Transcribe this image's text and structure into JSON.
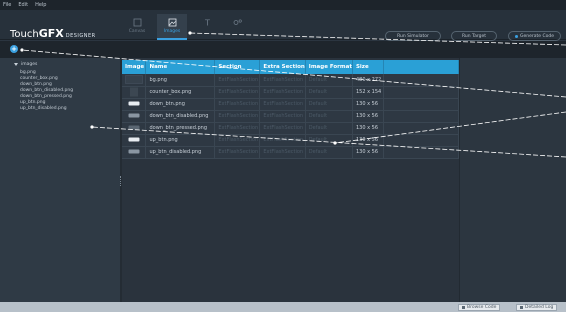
{
  "menu": {
    "file": "File",
    "edit": "Edit",
    "help": "Help"
  },
  "logo": {
    "touch": "Touch",
    "gfx": "GFX",
    "designer": "DESIGNER"
  },
  "tabs": [
    {
      "label": "Canvas",
      "icon": "canvas-icon"
    },
    {
      "label": "Images",
      "icon": "image-icon"
    },
    {
      "label": "",
      "icon": "text-icon"
    },
    {
      "label": "",
      "icon": "config-icon"
    }
  ],
  "actions": {
    "run_simulator": "Run Simulator",
    "run_target": "Run Target",
    "generate_code": "Generate Code"
  },
  "tree": {
    "root": "images",
    "items": [
      "bg.png",
      "counter_box.png",
      "down_btn.png",
      "down_btn_disabled.png",
      "down_btn_pressed.png",
      "up_btn.png",
      "up_btn_disabled.png"
    ]
  },
  "table": {
    "headers": [
      "Image",
      "Name",
      "Section",
      "Extra Section",
      "Image Format",
      "Size"
    ],
    "rows": [
      {
        "name": "bg.png",
        "section": "ExtFlashSection",
        "extra": "ExtFlashSection",
        "format": "Default",
        "size": "480 x 272",
        "thumb": "dark"
      },
      {
        "name": "counter_box.png",
        "section": "ExtFlashSection",
        "extra": "ExtFlashSection",
        "format": "Default",
        "size": "152 x 154",
        "thumb": "box"
      },
      {
        "name": "down_btn.png",
        "section": "ExtFlashSection",
        "extra": "ExtFlashSection",
        "format": "Default",
        "size": "130 x 56",
        "thumb": "btn"
      },
      {
        "name": "down_btn_disabled.png",
        "section": "ExtFlashSection",
        "extra": "ExtFlashSection",
        "format": "Default",
        "size": "130 x 56",
        "thumb": "btn-dim"
      },
      {
        "name": "down_btn_pressed.png",
        "section": "ExtFlashSection",
        "extra": "ExtFlashSection",
        "format": "Default",
        "size": "130 x 56",
        "thumb": "btn-dark"
      },
      {
        "name": "up_btn.png",
        "section": "ExtFlashSection",
        "extra": "ExtFlashSection",
        "format": "Default",
        "size": "130 x 56",
        "thumb": "btn"
      },
      {
        "name": "up_btn_disabled.png",
        "section": "ExtFlashSection",
        "extra": "ExtFlashSection",
        "format": "Default",
        "size": "130 x 56",
        "thumb": "btn-dim"
      }
    ]
  },
  "status": {
    "browse_code": "Browse Code",
    "detailed_log": "Detailed Log"
  },
  "colors": {
    "accent": "#2aa0d6",
    "background": "#2b3540",
    "annotation": "#ffffff"
  }
}
